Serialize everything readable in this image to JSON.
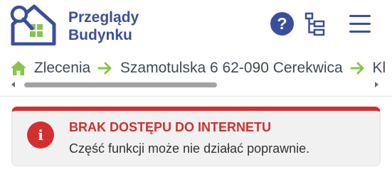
{
  "app": {
    "brand_line1": "Przeglądy",
    "brand_line2": "Budynku"
  },
  "header": {
    "help_label": "?",
    "icons": [
      "house-logo-icon",
      "question-icon",
      "sitemap-icon",
      "hamburger-menu-icon"
    ]
  },
  "breadcrumb": {
    "items": [
      "Zlecenia",
      "Szamotulska 6 62-090 Cerekwica",
      "Kl"
    ]
  },
  "alert": {
    "icon_label": "i",
    "title": "BRAK DOSTĘPU DO INTERNETU",
    "message": "Część funkcji może nie działać poprawnie."
  },
  "colors": {
    "brand": "#3a4f9c",
    "breadcrumb_accent": "#8bc34a",
    "alert": "#d32f2f"
  }
}
